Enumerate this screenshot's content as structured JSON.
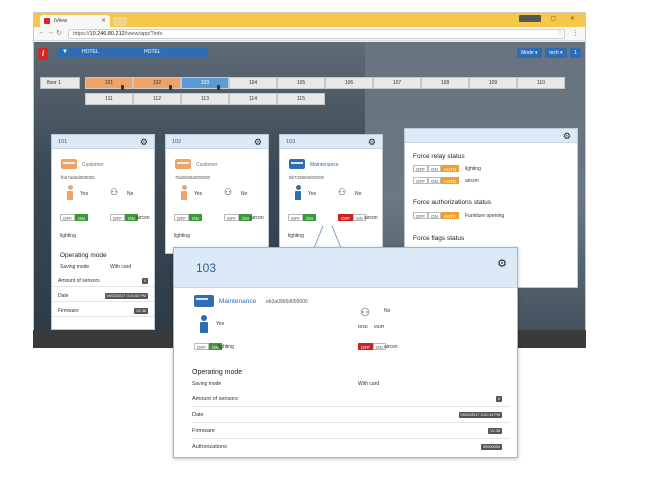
{
  "browser": {
    "tab_title": "iView",
    "url_prefix": "https://",
    "url_host": "10.246.80.212",
    "url_path": "/iview/app/?info",
    "window_controls": [
      "—",
      "▢",
      "✕"
    ]
  },
  "topnav": {
    "logo": "i",
    "hotel_left": "HOTEL",
    "hotel_right": "HOTEL",
    "right_buttons": [
      "Mode ▾",
      "tech ▾",
      "1"
    ]
  },
  "rooms": {
    "floor_label": "floor 1",
    "row1": [
      "101",
      "102",
      "103",
      "104",
      "105",
      "106",
      "107",
      "108",
      "109",
      "110"
    ],
    "row2": [
      "111",
      "112",
      "113",
      "114",
      "115"
    ]
  },
  "card101": {
    "number": "101",
    "status": "Customer",
    "id": "fbb7a66d000000",
    "presence": "Yes",
    "dnd": "No",
    "off": "OFF",
    "on": "ON",
    "aircon": "aircon",
    "lighting": "lighting",
    "op_mode_title": "Operating mode",
    "saving_mode_label": "Saving mode",
    "saving_mode_value": "With card",
    "sensors_label": "Amount of sensors",
    "sensors_value": "0",
    "date_label": "Date",
    "date_value": "09/22/2017 3:21:52 PM",
    "firmware_label": "Firmware",
    "firmware_value": "V2.36"
  },
  "card102": {
    "number": "102",
    "status": "Customer",
    "id": "7bd6006d000000",
    "presence": "Yes",
    "dnd": "No",
    "off": "OFF",
    "on": "ON",
    "aircon": "aircon",
    "lighting": "lighting"
  },
  "card103": {
    "number": "103",
    "status": "Maintenance",
    "id": "8b733866000000",
    "presence": "Yes",
    "dnd": "No",
    "off": "OFF",
    "on": "ON",
    "aircon": "aircon",
    "lighting": "lighting"
  },
  "force": {
    "relay_title": "Force relay status",
    "auth_title": "Force authorizations status",
    "flags_title": "Force flags status",
    "off": "OFF",
    "on": "ON",
    "auto": "AUTO",
    "lighting": "lighting",
    "aircon": "aircon",
    "furniture": "Furniture opening"
  },
  "popup": {
    "number": "103",
    "status": "Maintenance",
    "id": "eb3a0966d000000",
    "presence": "Yes",
    "dnd_label": "No",
    "dnd_left": "DND",
    "dnd_right": "MUR",
    "off": "OFF",
    "on": "ON",
    "lighting": "lighting",
    "aircon": "aircon",
    "op_mode_title": "Operating mode",
    "saving_mode_label": "Saving mode",
    "saving_mode_value": "With card",
    "sensors_label": "Amount of sensors",
    "sensors_value": "0",
    "date_label": "Date",
    "date_value": "09/22/2017 3:21:13 PM",
    "firmware_label": "Firmware",
    "firmware_value": "V2.36",
    "auth_label": "Authorizations",
    "auth_value": "00000000"
  },
  "colors": {
    "customer": "#f0a366",
    "maintenance": "#2f6cb3",
    "on_green": "#3a9a3a",
    "off_red": "#cc2222",
    "auto_orange": "#f0a030"
  }
}
